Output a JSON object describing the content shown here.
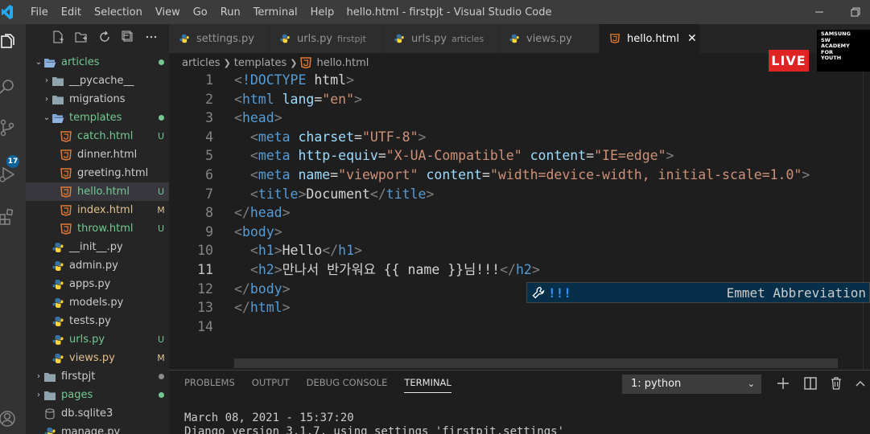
{
  "titlebar": {
    "menu": [
      "File",
      "Edit",
      "Selection",
      "View",
      "Go",
      "Run",
      "Terminal",
      "Help"
    ],
    "title": "hello.html - firstpjt - Visual Studio Code"
  },
  "activity": {
    "source_control_badge": "17"
  },
  "explorer": {
    "items": [
      {
        "name": "articles",
        "type": "folder-open",
        "indent": 0,
        "status": "dot",
        "color": "#73c991"
      },
      {
        "name": "__pycache__",
        "type": "folder",
        "indent": 1,
        "status": "",
        "color": "#cccccc"
      },
      {
        "name": "migrations",
        "type": "folder",
        "indent": 1,
        "status": "",
        "color": "#cccccc"
      },
      {
        "name": "templates",
        "type": "folder-open",
        "indent": 1,
        "status": "dot",
        "color": "#73c991"
      },
      {
        "name": "catch.html",
        "type": "html",
        "indent": 2,
        "status": "U",
        "color": "#73c991"
      },
      {
        "name": "dinner.html",
        "type": "html",
        "indent": 2,
        "status": "",
        "color": "#cccccc"
      },
      {
        "name": "greeting.html",
        "type": "html",
        "indent": 2,
        "status": "",
        "color": "#cccccc"
      },
      {
        "name": "hello.html",
        "type": "html",
        "indent": 2,
        "status": "U",
        "color": "#73c991",
        "active": true
      },
      {
        "name": "index.html",
        "type": "html",
        "indent": 2,
        "status": "M",
        "color": "#e2c08d"
      },
      {
        "name": "throw.html",
        "type": "html",
        "indent": 2,
        "status": "U",
        "color": "#73c991"
      },
      {
        "name": "__init__.py",
        "type": "py",
        "indent": 1,
        "status": "",
        "color": "#cccccc"
      },
      {
        "name": "admin.py",
        "type": "py",
        "indent": 1,
        "status": "",
        "color": "#cccccc"
      },
      {
        "name": "apps.py",
        "type": "py",
        "indent": 1,
        "status": "",
        "color": "#cccccc"
      },
      {
        "name": "models.py",
        "type": "py",
        "indent": 1,
        "status": "",
        "color": "#cccccc"
      },
      {
        "name": "tests.py",
        "type": "py",
        "indent": 1,
        "status": "",
        "color": "#cccccc"
      },
      {
        "name": "urls.py",
        "type": "py",
        "indent": 1,
        "status": "U",
        "color": "#73c991"
      },
      {
        "name": "views.py",
        "type": "py",
        "indent": 1,
        "status": "M",
        "color": "#e2c08d"
      },
      {
        "name": "firstpjt",
        "type": "folder",
        "indent": 0,
        "status": "dot",
        "color": "#cccccc"
      },
      {
        "name": "pages",
        "type": "folder",
        "indent": 0,
        "status": "dot",
        "color": "#73c991"
      },
      {
        "name": "db.sqlite3",
        "type": "db",
        "indent": 0,
        "status": "",
        "color": "#cccccc"
      },
      {
        "name": "manage.py",
        "type": "py",
        "indent": 0,
        "status": "",
        "color": "#cccccc"
      }
    ]
  },
  "tabs": [
    {
      "label": "settings.py",
      "desc": "",
      "icon": "py",
      "active": false,
      "width": 125
    },
    {
      "label": "urls.py",
      "desc": "firstpjt",
      "icon": "py",
      "active": false,
      "width": 142
    },
    {
      "label": "urls.py",
      "desc": "articles",
      "icon": "py",
      "active": false,
      "width": 143
    },
    {
      "label": "views.py",
      "desc": "",
      "icon": "py",
      "active": false,
      "width": 125
    },
    {
      "label": "hello.html",
      "desc": "",
      "icon": "html",
      "active": true,
      "width": 125
    }
  ],
  "breadcrumbs": [
    "articles",
    "templates",
    "hello.html"
  ],
  "editor": {
    "current_line": 11,
    "lines": [
      {
        "n": "1",
        "indent": "",
        "tokens": [
          [
            "br",
            "<"
          ],
          [
            "tg",
            "!DOCTYPE"
          ],
          [
            "tx",
            " html"
          ],
          [
            "br",
            ">"
          ]
        ]
      },
      {
        "n": "2",
        "indent": "",
        "tokens": [
          [
            "br",
            "<"
          ],
          [
            "tg",
            "html"
          ],
          [
            "at",
            " lang"
          ],
          [
            "tx",
            "="
          ],
          [
            "sv",
            "\"en\""
          ],
          [
            "br",
            ">"
          ]
        ]
      },
      {
        "n": "3",
        "indent": "",
        "tokens": [
          [
            "br",
            "<"
          ],
          [
            "tg",
            "head"
          ],
          [
            "br",
            ">"
          ]
        ]
      },
      {
        "n": "4",
        "indent": "  ",
        "tokens": [
          [
            "br",
            "<"
          ],
          [
            "tg",
            "meta"
          ],
          [
            "at",
            " charset"
          ],
          [
            "tx",
            "="
          ],
          [
            "sv",
            "\"UTF-8\""
          ],
          [
            "br",
            ">"
          ]
        ]
      },
      {
        "n": "5",
        "indent": "  ",
        "tokens": [
          [
            "br",
            "<"
          ],
          [
            "tg",
            "meta"
          ],
          [
            "at",
            " http-equiv"
          ],
          [
            "tx",
            "="
          ],
          [
            "sv",
            "\"X-UA-Compatible\""
          ],
          [
            "at",
            " content"
          ],
          [
            "tx",
            "="
          ],
          [
            "sv",
            "\"IE=edge\""
          ],
          [
            "br",
            ">"
          ]
        ]
      },
      {
        "n": "6",
        "indent": "  ",
        "tokens": [
          [
            "br",
            "<"
          ],
          [
            "tg",
            "meta"
          ],
          [
            "at",
            " name"
          ],
          [
            "tx",
            "="
          ],
          [
            "sv",
            "\"viewport\""
          ],
          [
            "at",
            " content"
          ],
          [
            "tx",
            "="
          ],
          [
            "sv",
            "\"width=device-width, initial-scale=1.0\""
          ],
          [
            "br",
            ">"
          ]
        ]
      },
      {
        "n": "7",
        "indent": "  ",
        "tokens": [
          [
            "br",
            "<"
          ],
          [
            "tg",
            "title"
          ],
          [
            "br",
            ">"
          ],
          [
            "tx",
            "Document"
          ],
          [
            "br",
            "</"
          ],
          [
            "tg",
            "title"
          ],
          [
            "br",
            ">"
          ]
        ]
      },
      {
        "n": "8",
        "indent": "",
        "tokens": [
          [
            "br",
            "</"
          ],
          [
            "tg",
            "head"
          ],
          [
            "br",
            ">"
          ]
        ]
      },
      {
        "n": "9",
        "indent": "",
        "tokens": [
          [
            "br",
            "<"
          ],
          [
            "tg",
            "body"
          ],
          [
            "br",
            ">"
          ]
        ]
      },
      {
        "n": "10",
        "indent": "  ",
        "tokens": [
          [
            "br",
            "<"
          ],
          [
            "tg",
            "h1"
          ],
          [
            "br",
            ">"
          ],
          [
            "tx",
            "Hello"
          ],
          [
            "br",
            "</"
          ],
          [
            "tg",
            "h1"
          ],
          [
            "br",
            ">"
          ]
        ]
      },
      {
        "n": "11",
        "indent": "  ",
        "tokens": [
          [
            "br",
            "<"
          ],
          [
            "tg",
            "h2"
          ],
          [
            "br",
            ">"
          ],
          [
            "tx",
            "만나서 반가워요 {{ name }}님!!!"
          ],
          [
            "br",
            "</"
          ],
          [
            "tg",
            "h2"
          ],
          [
            "br",
            ">"
          ]
        ]
      },
      {
        "n": "12",
        "indent": "",
        "tokens": [
          [
            "br",
            "</"
          ],
          [
            "tg",
            "body"
          ],
          [
            "br",
            ">"
          ]
        ]
      },
      {
        "n": "13",
        "indent": "",
        "tokens": [
          [
            "br",
            "</"
          ],
          [
            "tg",
            "html"
          ],
          [
            "br",
            ">"
          ]
        ]
      },
      {
        "n": "14",
        "indent": "",
        "tokens": []
      }
    ]
  },
  "suggest": {
    "label": "!!!",
    "detail": "Emmet Abbreviation"
  },
  "panel": {
    "tabs": [
      "PROBLEMS",
      "OUTPUT",
      "DEBUG CONSOLE",
      "TERMINAL"
    ],
    "active_tab": "TERMINAL",
    "terminal_select": "1: python",
    "terminal_lines": [
      "March 08, 2021 - 15:37:20",
      "Django version 3.1.7, using settings 'firstpjt.settings'"
    ]
  },
  "overlay": {
    "live": "LIVE",
    "academy": [
      "SAMSUNG",
      "SW",
      "ACADEMY",
      "FOR",
      "YOUTH"
    ]
  },
  "colors": {
    "accent": "#007acc",
    "untracked": "#73c991",
    "modified": "#e2c08d",
    "html_icon": "#e37933",
    "py_icon": "#3572a5"
  }
}
